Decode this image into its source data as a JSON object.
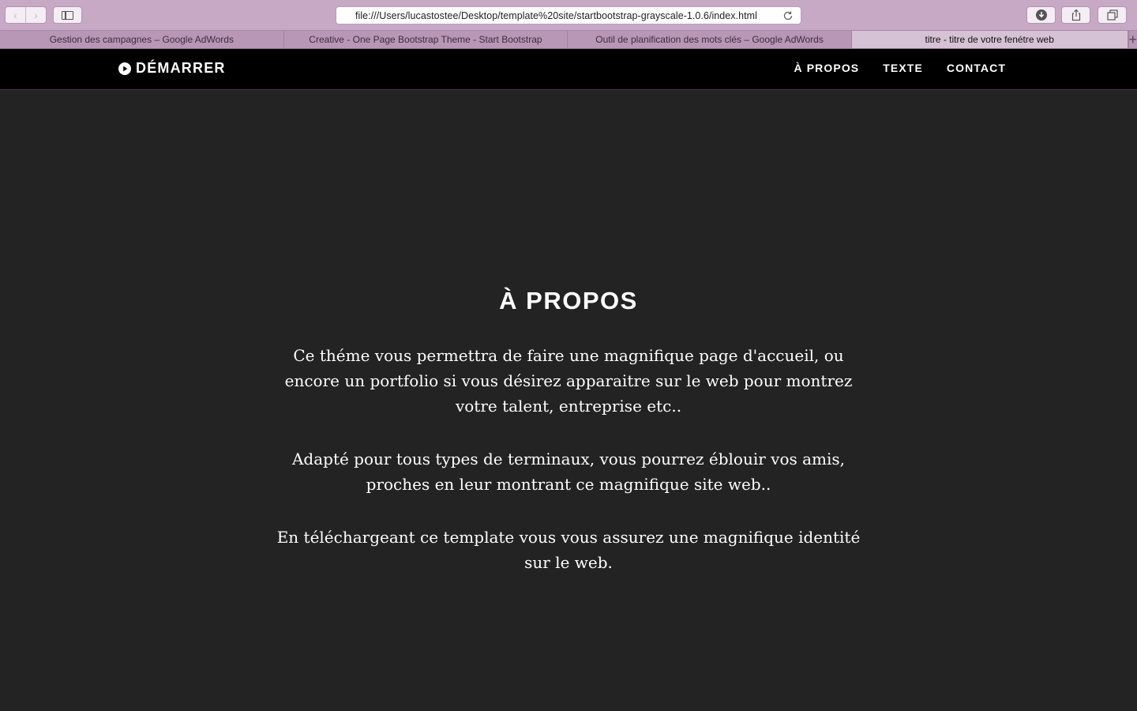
{
  "browser": {
    "url": "file:///Users/lucastostee/Desktop/template%20site/startbootstrap-grayscale-1.0.6/index.html",
    "tabs": [
      {
        "label": "Gestion des campagnes – Google AdWords"
      },
      {
        "label": "Creative - One Page Bootstrap Theme - Start Bootstrap"
      },
      {
        "label": "Outil de planification des mots clés – Google AdWords"
      },
      {
        "label": "titre - titre de votre fenétre web"
      }
    ],
    "new_tab_icon": "plus-icon",
    "icons": [
      "back-icon",
      "forward-icon",
      "sidebar-icon",
      "reload-icon",
      "download-icon",
      "share-icon",
      "tabs-overview-icon"
    ]
  },
  "navbar": {
    "brand": "DÉMARRER",
    "brand_icon": "play-circle-icon",
    "links": [
      {
        "label": "À PROPOS"
      },
      {
        "label": "TEXTE"
      },
      {
        "label": "CONTACT"
      }
    ]
  },
  "about": {
    "title": "À PROPOS",
    "paragraphs": [
      "Ce théme vous permettra de faire une magnifique page d'accueil, ou encore un portfolio si vous désirez apparaitre sur le web pour montrez votre talent, entreprise etc..",
      "Adapté pour tous types de terminaux, vous pourrez éblouir vos amis, proches en leur montrant ce magnifique site web..",
      "En téléchargeant ce template vous vous assurez une magnifique identité sur le web."
    ]
  },
  "colors": {
    "chrome": "#c7a9c6",
    "navbar_bg": "#000000",
    "page_bg": "#232323",
    "text": "#ffffff"
  }
}
